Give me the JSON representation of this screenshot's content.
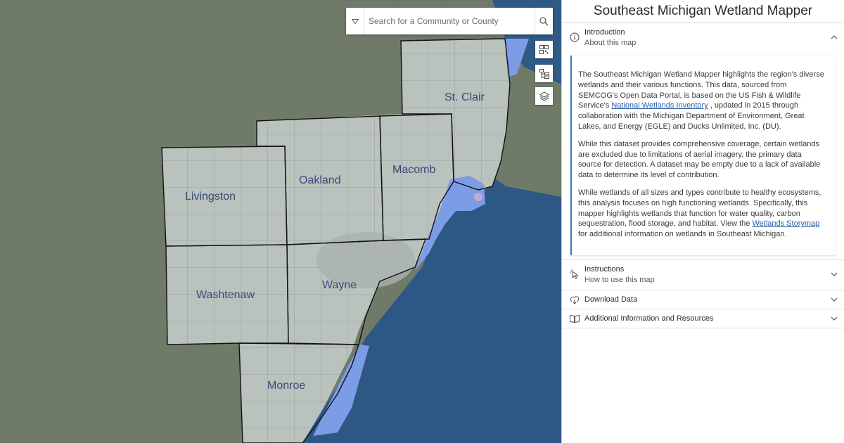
{
  "map": {
    "search": {
      "placeholder": "Search for a Community or County",
      "value": ""
    },
    "counties": [
      {
        "name": "St. Clair"
      },
      {
        "name": "Livingston"
      },
      {
        "name": "Oakland"
      },
      {
        "name": "Macomb"
      },
      {
        "name": "Washtenaw"
      },
      {
        "name": "Wayne"
      },
      {
        "name": "Monroe"
      }
    ],
    "tools": [
      {
        "icon": "qr-code-icon"
      },
      {
        "icon": "layer-tree-icon"
      },
      {
        "icon": "layers-icon"
      }
    ],
    "colors": {
      "land": "#6f7a69",
      "region": "#b9c2bc",
      "lake": "#2f5a85",
      "water_highlight": "#7d9ce6",
      "county_border": "#111111"
    }
  },
  "panel": {
    "title": "Southeast Michigan Wetland Mapper",
    "sections": [
      {
        "heading": "Introduction",
        "subheading": "About this map",
        "icon": "info-icon",
        "expanded": true,
        "paragraphs": {
          "p1_a": "The Southeast Michigan Wetland Mapper highlights the region's diverse wetlands and their various functions. This data, sourced from SEMCOG's Open Data Portal, is based on the US Fish & Wildlife Service's ",
          "p1_link": "National Wetlands Inventory",
          "p1_b": " , updated in 2015 through collaboration with the Michigan Department of Environment, Great Lakes, and Energy (EGLE) and Ducks Unlimited, Inc. (DU).",
          "p2": "While this dataset provides comprehensive coverage, certain wetlands are excluded due to limitations of aerial imagery, the primary data source for detection. A dataset may be empty due to a lack of available data to determine its level of contribution.",
          "p3_a": "While wetlands of all sizes and types contribute to healthy ecosystems, this analysis focuses on high functioning wetlands. Specifically, this mapper highlights wetlands that function for water quality, carbon sequestration, flood storage, and habitat. View the ",
          "p3_link": "Wetlands Storymap",
          "p3_b": " for additional information on wetlands in Southeast Michigan."
        }
      },
      {
        "heading": "Instructions",
        "subheading": "How to use this map",
        "icon": "cursor-icon",
        "expanded": false
      },
      {
        "heading": "Download Data",
        "icon": "download-icon",
        "expanded": false
      },
      {
        "heading": "Additional Information and Resources",
        "icon": "book-icon",
        "expanded": false
      }
    ]
  }
}
